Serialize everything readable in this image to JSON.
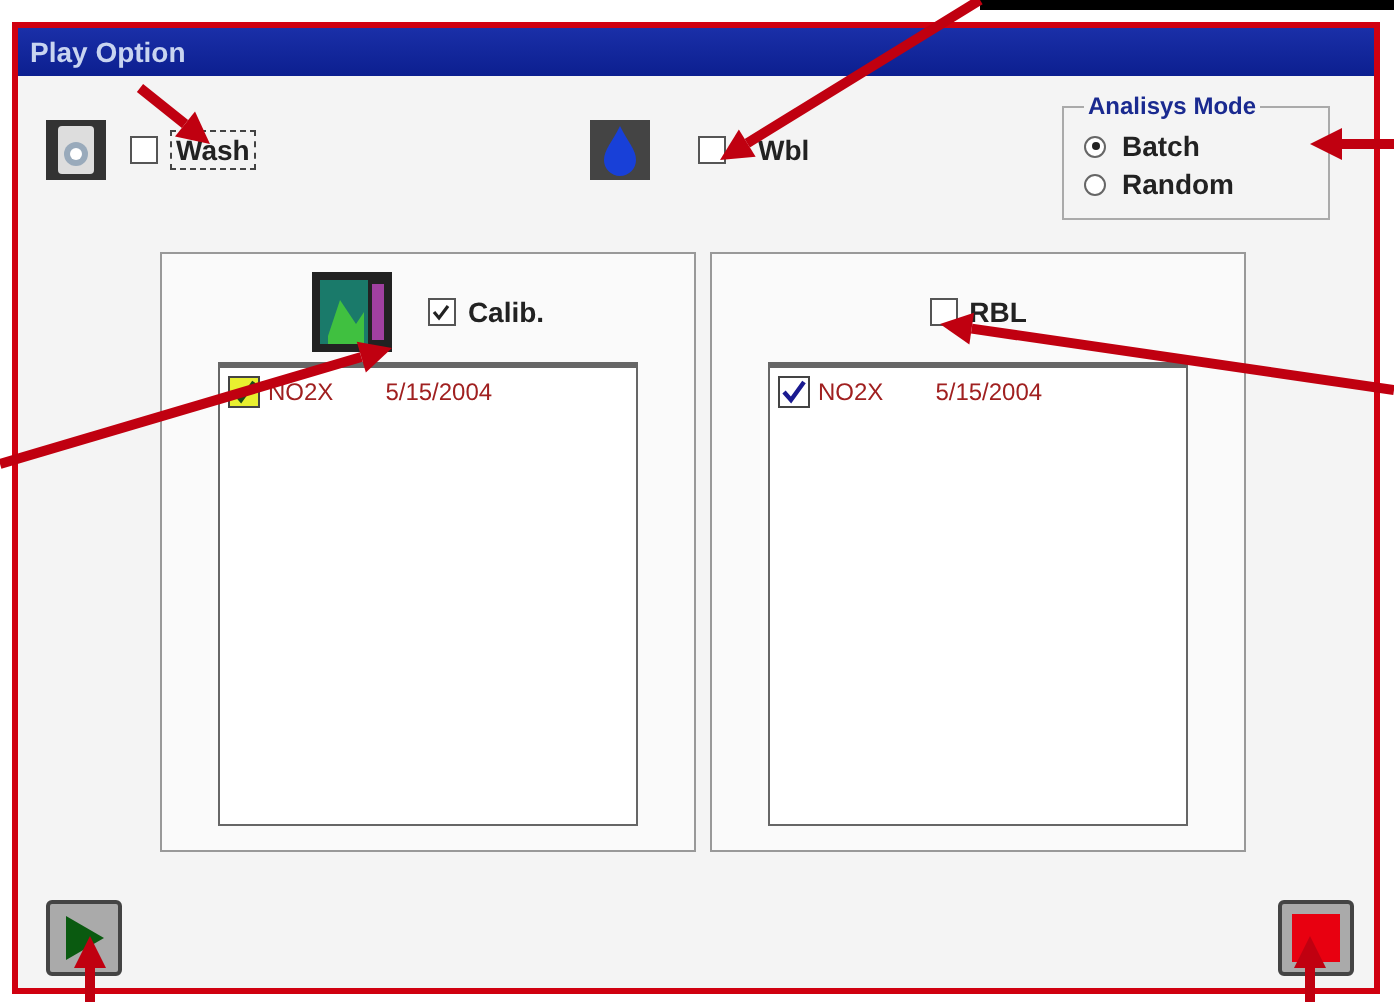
{
  "window": {
    "title": "Play Option"
  },
  "options": [
    {
      "label": "Wash",
      "checked": false,
      "kind": "washer"
    },
    {
      "label": "Wbl",
      "checked": false,
      "kind": "drop"
    }
  ],
  "analysis_mode": {
    "title": "Analisys Mode",
    "choices": [
      {
        "label": "Batch",
        "selected": true
      },
      {
        "label": "Random",
        "selected": false
      }
    ]
  },
  "panels": [
    {
      "label": "Calib.",
      "checked": true,
      "kind": "chart",
      "items": [
        {
          "name": "NO2X",
          "date": "5/15/2004",
          "checked": true,
          "color": "#e8f030"
        }
      ]
    },
    {
      "label": "RBL",
      "checked": false,
      "items": [
        {
          "name": "NO2X",
          "date": "5/15/2004",
          "checked": true,
          "color": "#ffffff"
        }
      ]
    }
  ]
}
